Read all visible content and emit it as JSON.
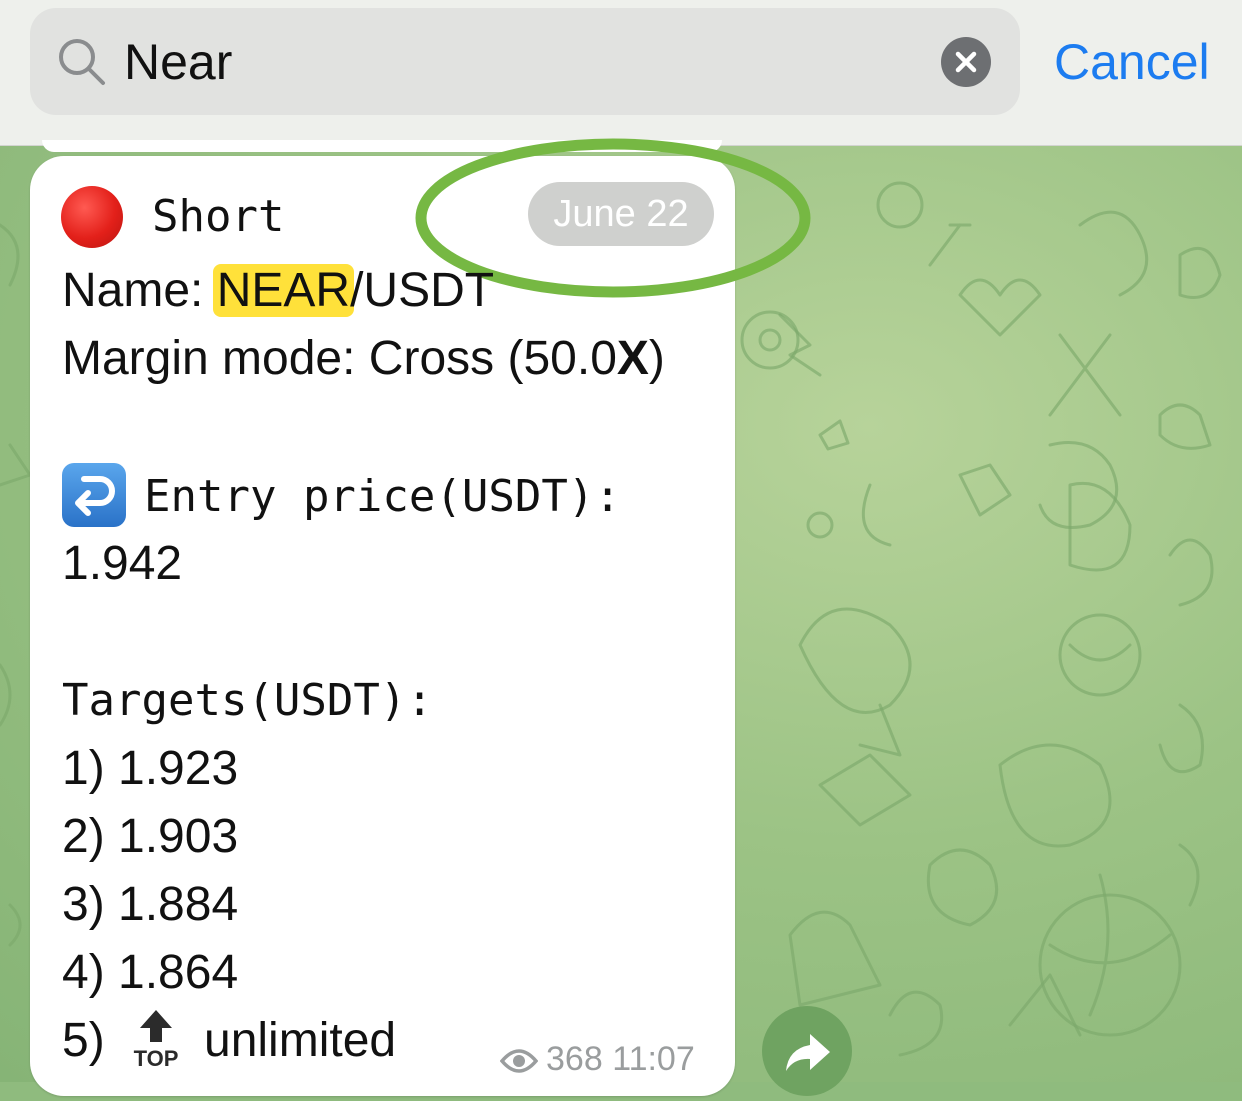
{
  "search": {
    "query": "Near",
    "cancel_label": "Cancel"
  },
  "message": {
    "date_badge": "June 22",
    "direction": "Short",
    "name_label": "Name: ",
    "name_highlight": "NEAR",
    "name_rest": "/USDT",
    "margin_prefix": "Margin mode: Cross (50.0",
    "margin_bold": "X",
    "margin_suffix": ")",
    "entry_label": "Entry price(USDT):",
    "entry_value": "1.942",
    "targets_label": "Targets(USDT):",
    "targets": [
      "1) 1.923",
      "2) 1.903",
      "3) 1.884",
      "4) 1.864"
    ],
    "target5_prefix": "5)",
    "target5_icon_text": "TOP",
    "target5_value": "unlimited",
    "views": "368",
    "time": "11:07"
  },
  "colors": {
    "accent": "#1c7cf0",
    "highlight": "#ffe13a",
    "ring": "#76b843",
    "wallpaper": "#9cc385"
  }
}
